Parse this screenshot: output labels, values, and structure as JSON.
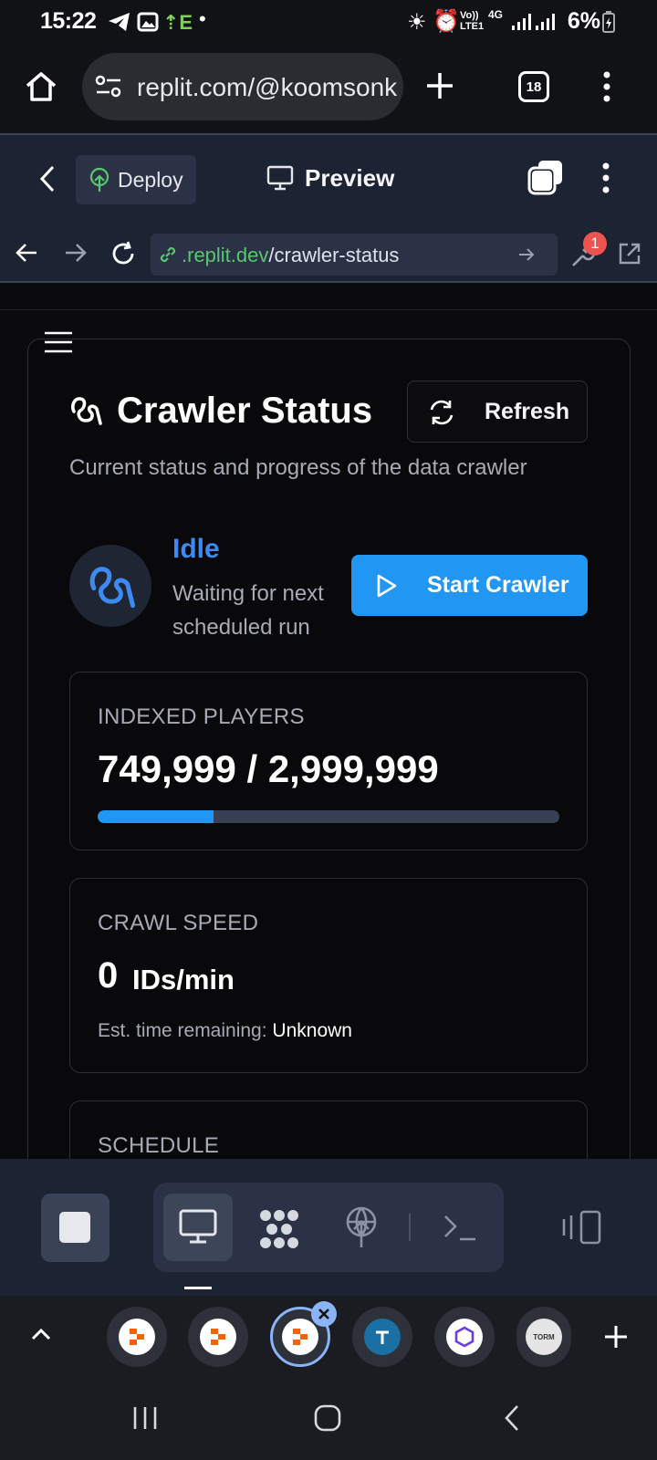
{
  "status_bar": {
    "time": "15:22",
    "network": "4G",
    "battery": "6%"
  },
  "browser": {
    "url": "replit.com/@koomsonk",
    "tab_count": "18"
  },
  "replit_header": {
    "deploy_label": "Deploy",
    "preview_label": "Preview"
  },
  "inner_browser": {
    "url_domain": ".replit.dev",
    "url_path": "/crawler-status",
    "devtools_badge": "1"
  },
  "page": {
    "title": "Crawler Status",
    "refresh_label": "Refresh",
    "subtitle": "Current status and progress of the data crawler",
    "status": {
      "label": "Idle",
      "description": "Waiting for next scheduled run"
    },
    "start_label": "Start Crawler",
    "indexed": {
      "label": "INDEXED PLAYERS",
      "value": "749,999 / 2,999,999",
      "progress_fraction": 0.25
    },
    "speed": {
      "label": "CRAWL SPEED",
      "value": "0",
      "unit": "IDs/min",
      "est_label": "Est. time remaining:",
      "est_value": "Unknown"
    },
    "schedule": {
      "label": "SCHEDULE"
    }
  },
  "colors": {
    "accent_blue": "#2196f3",
    "status_idle": "#3d8bf2",
    "replit_bg": "#1c2333",
    "link_green": "#58c771"
  },
  "toolbar": {
    "icons": [
      "stop-icon",
      "preview-icon",
      "workspace-icon",
      "deploy-icon",
      "shell-icon",
      "devices-icon"
    ]
  },
  "tabs": {
    "icons": [
      "replit-icon",
      "replit-icon",
      "replit-icon",
      "app-icon",
      "hexagon-icon",
      "torm-icon"
    ],
    "torm_text": "TORM"
  }
}
